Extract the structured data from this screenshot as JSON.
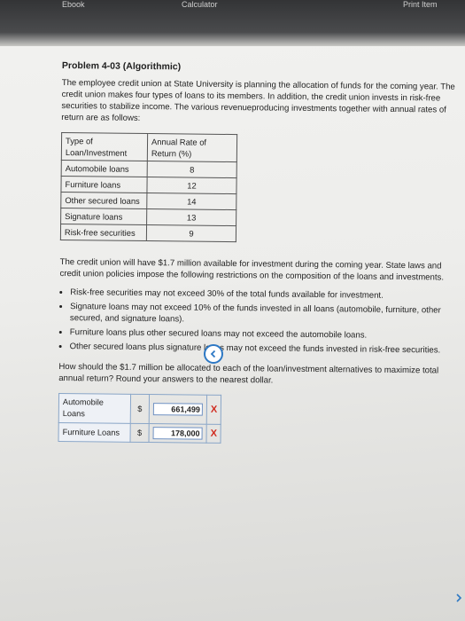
{
  "topbar": {
    "left_tab": "Ebook",
    "center_tab": "Calculator",
    "right_tab": "Print Item"
  },
  "problem": {
    "title": "Problem 4-03 (Algorithmic)",
    "intro": "The employee credit union at State University is planning the allocation of funds for the coming year. The credit union makes four types of loans to its members. In addition, the credit union invests in risk-free securities to stabilize income. The various revenueproducing investments together with annual rates of return are as follows:",
    "table": {
      "headers": [
        "Type of Loan/Investment",
        "Annual Rate of Return (%)"
      ],
      "rows": [
        [
          "Automobile loans",
          "8"
        ],
        [
          "Furniture loans",
          "12"
        ],
        [
          "Other secured loans",
          "14"
        ],
        [
          "Signature loans",
          "13"
        ],
        [
          "Risk-free securities",
          "9"
        ]
      ]
    },
    "constraints_intro": "The credit union will have $1.7 million available for investment during the coming year. State laws and credit union policies impose the following restrictions on the composition of the loans and investments.",
    "rules": [
      "Risk-free securities may not exceed 30% of the total funds available for investment.",
      "Signature loans may not exceed 10% of the funds invested in all loans (automobile, furniture, other secured, and signature loans).",
      "Furniture loans plus other secured loans may not exceed the automobile loans.",
      "Other secured loans plus signature loans may not exceed the funds invested in risk-free securities."
    ],
    "question": "How should the $1.7 million be allocated to each of the loan/investment alternatives to maximize total annual return? Round your answers to the nearest dollar.",
    "answers": [
      {
        "label": "Automobile Loans",
        "currency": "$",
        "value": "661,499",
        "mark": "X"
      },
      {
        "label": "Furniture Loans",
        "currency": "$",
        "value": "178,000",
        "mark": "X"
      }
    ]
  },
  "colors": {
    "accent": "#2d78c4",
    "wrong": "#d0281c"
  }
}
